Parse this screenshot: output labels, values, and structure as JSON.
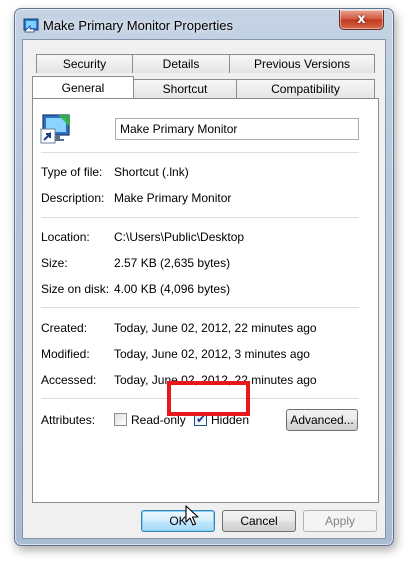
{
  "window": {
    "title": "Make Primary Monitor Properties",
    "close_glyph": "x"
  },
  "tabs": {
    "row1": [
      "Security",
      "Details",
      "Previous Versions"
    ],
    "row2": [
      "General",
      "Shortcut",
      "Compatibility"
    ],
    "active": "General"
  },
  "general": {
    "name_value": "Make Primary Monitor",
    "type_label": "Type of file:",
    "type_value": "Shortcut (.lnk)",
    "description_label": "Description:",
    "description_value": "Make Primary Monitor",
    "location_label": "Location:",
    "location_value": "C:\\Users\\Public\\Desktop",
    "size_label": "Size:",
    "size_value": "2.57 KB (2,635 bytes)",
    "size_on_disk_label": "Size on disk:",
    "size_on_disk_value": "4.00 KB (4,096 bytes)",
    "created_label": "Created:",
    "created_value": "Today, June 02, 2012, 22 minutes ago",
    "modified_label": "Modified:",
    "modified_value": "Today, June 02, 2012, 3 minutes ago",
    "accessed_label": "Accessed:",
    "accessed_value": "Today, June 02, 2012, 22 minutes ago",
    "attributes_label": "Attributes:",
    "readonly_label": "Read-only",
    "readonly_checked": false,
    "hidden_label": "Hidden",
    "hidden_checked": true,
    "advanced_label": "Advanced..."
  },
  "footer": {
    "ok_label": "OK",
    "cancel_label": "Cancel",
    "apply_label": "Apply"
  },
  "colors": {
    "highlight_border": "#e8171b",
    "close_button": "#c0391f",
    "default_button_border": "#3c7fb1"
  }
}
